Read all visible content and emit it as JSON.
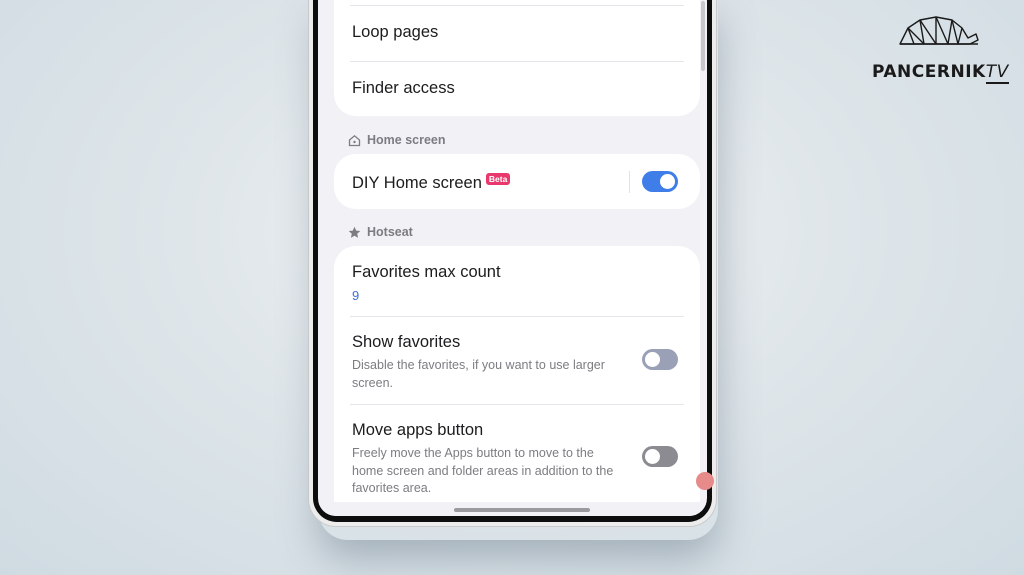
{
  "brand": {
    "name": "PANCERNIK",
    "suffix": "TV"
  },
  "lists": {
    "loop_pages": "Loop pages",
    "finder_access": "Finder access"
  },
  "sections": {
    "home_screen": "Home screen",
    "hotseat": "Hotseat"
  },
  "home": {
    "diy_title": "DIY Home screen",
    "beta_badge": "Beta",
    "diy_enabled": true
  },
  "hotseat": {
    "favorites_max_title": "Favorites max count",
    "favorites_max_value": "9",
    "show_favorites_title": "Show favorites",
    "show_favorites_desc": "Disable the favorites, if you want to use larger screen.",
    "show_favorites_enabled": false,
    "move_apps_title": "Move apps button",
    "move_apps_desc": "Freely move the Apps button to move to the home screen and folder areas in addition to the favorites area.",
    "move_apps_enabled": false
  },
  "colors": {
    "accent": "#3f7ee8",
    "beta": "#e8386d",
    "value_blue": "#3a6fd8",
    "background": "#f2f1f6"
  },
  "icons": [
    "home-outline-icon",
    "star-icon",
    "armadillo-logo"
  ]
}
